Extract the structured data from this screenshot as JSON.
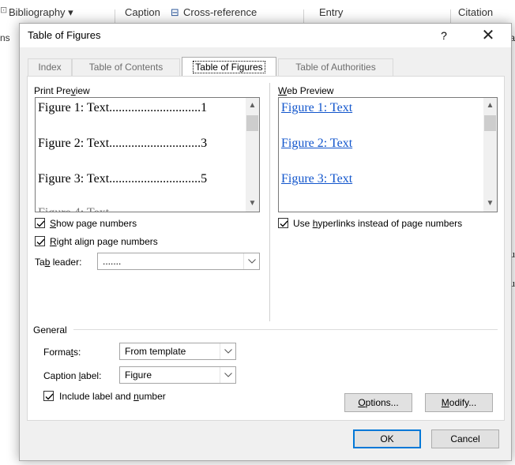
{
  "ribbon": {
    "bibliography": "Bibliography",
    "caption": "Caption",
    "cross_reference": "Cross-reference",
    "entry": "Entry",
    "citation": "Citation"
  },
  "background": {
    "left_frag": "ns",
    "right_frag_1": "a",
    "right_frag_2": "u",
    "right_frag_3": "u"
  },
  "dialog": {
    "title": "Table of Figures",
    "help": "?",
    "close": "✕",
    "tabs": [
      {
        "label": "Index",
        "active": false
      },
      {
        "label": "Table of Contents",
        "active": false
      },
      {
        "label": "Table of Figures",
        "active": true
      },
      {
        "label": "Table of Authorities",
        "active": false
      }
    ],
    "print_preview": {
      "label_pre": "Print Pre",
      "label_key": "v",
      "label_post": "iew",
      "lines": [
        "Figure 1: Text.............................1",
        "Figure 2: Text.............................3",
        "Figure 3: Text.............................5"
      ]
    },
    "web_preview": {
      "label_pre": "",
      "label_key": "W",
      "label_post": "eb Preview",
      "lines": [
        "Figure 1: Text",
        "Figure 2: Text",
        "Figure 3: Text"
      ]
    },
    "show_page_numbers": {
      "pre": "",
      "key": "S",
      "post": "how page numbers",
      "checked": true
    },
    "right_align": {
      "pre": "",
      "key": "R",
      "post": "ight align page numbers",
      "checked": true
    },
    "tab_leader": {
      "pre": "Ta",
      "key": "b",
      "post": " leader:",
      "value": "......."
    },
    "use_hyperlinks": {
      "pre": "Use ",
      "key": "h",
      "post": "yperlinks instead of page numbers",
      "checked": true
    },
    "general": {
      "label": "General",
      "formats": {
        "pre": "Forma",
        "key": "t",
        "post": "s:",
        "value": "From template"
      },
      "caption_label": {
        "pre": "Caption ",
        "key": "l",
        "post": "abel:",
        "value": "Figure"
      },
      "include_label": {
        "pre": "Include label and ",
        "key": "n",
        "post": "umber",
        "checked": true
      }
    },
    "buttons": {
      "options": {
        "pre": "",
        "key": "O",
        "post": "ptions..."
      },
      "modify": {
        "pre": "",
        "key": "M",
        "post": "odify..."
      },
      "ok": "OK",
      "cancel": "Cancel"
    }
  }
}
